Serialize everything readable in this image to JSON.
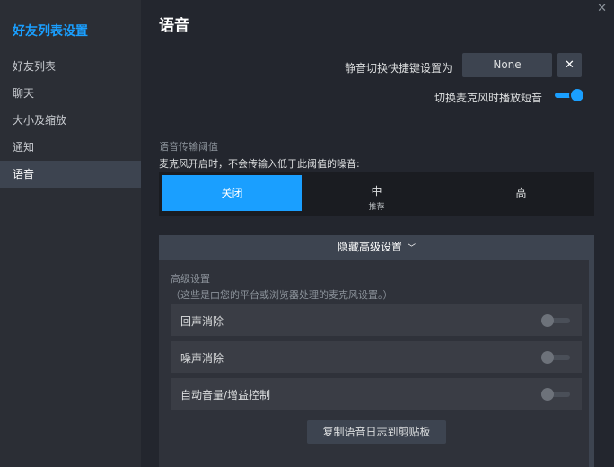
{
  "sidebar": {
    "title": "好友列表设置",
    "items": [
      {
        "label": "好友列表"
      },
      {
        "label": "聊天"
      },
      {
        "label": "大小及缩放"
      },
      {
        "label": "通知"
      },
      {
        "label": "语音",
        "active": true
      }
    ]
  },
  "window": {
    "close_icon": "close-icon"
  },
  "page": {
    "title": "语音"
  },
  "hotkey": {
    "label": "静音切换快捷键设置为",
    "value": "None",
    "clear_symbol": "✕"
  },
  "toggle_mic_sound": {
    "label": "切换麦克风时播放短音",
    "enabled": true
  },
  "threshold": {
    "title": "语音传输阈值",
    "description": "麦克风开启时，不会传输入低于此阈值的噪音:",
    "options": [
      {
        "label": "关闭",
        "sub": "",
        "selected": true
      },
      {
        "label": "中",
        "sub": "推荐",
        "selected": false
      },
      {
        "label": "高",
        "sub": "",
        "selected": false
      }
    ]
  },
  "advanced": {
    "toggle_label": "隐藏高级设置",
    "chevron_symbol": "﹀",
    "title": "高级设置",
    "description": "（这些是由您的平台或浏览器处理的麦克风设置。）",
    "rows": [
      {
        "label": "回声消除",
        "enabled": false
      },
      {
        "label": "噪声消除",
        "enabled": false
      },
      {
        "label": "自动音量/增益控制",
        "enabled": false
      }
    ],
    "copy_button": "复制语音日志到剪贴板"
  },
  "colors": {
    "accent": "#1a9fff",
    "background": "#23262e",
    "sidebar": "#2b2e35"
  }
}
